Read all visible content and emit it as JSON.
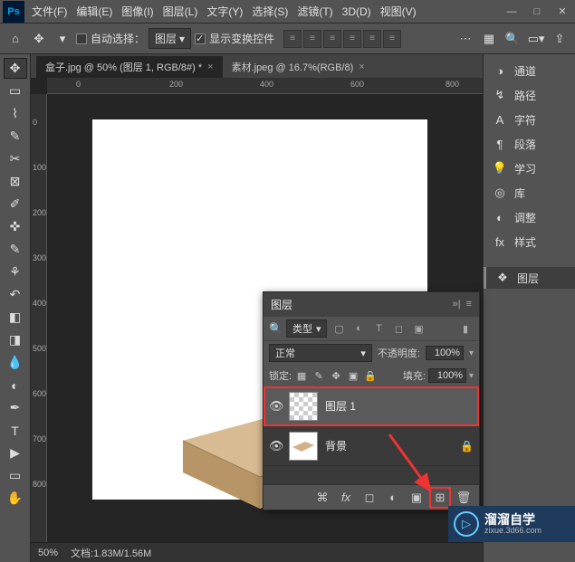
{
  "menu": {
    "items": [
      "文件(F)",
      "编辑(E)",
      "图像(I)",
      "图层(L)",
      "文字(Y)",
      "选择(S)",
      "滤镜(T)",
      "3D(D)",
      "视图(V)"
    ]
  },
  "options": {
    "auto_select_label": "自动选择：",
    "auto_select_target": "图层",
    "show_transform_controls": "显示变换控件"
  },
  "tabs": [
    {
      "label": "盒子.jpg @ 50% (图层 1, RGB/8#) *",
      "active": true
    },
    {
      "label": "素材.jpeg @ 16.7%(RGB/8)",
      "active": false
    }
  ],
  "ruler_h": [
    "0",
    "200",
    "400",
    "600",
    "800"
  ],
  "ruler_v": [
    "0",
    "100",
    "200",
    "300",
    "400",
    "500",
    "600",
    "700",
    "800"
  ],
  "status": {
    "zoom": "50%",
    "doc": "文档:",
    "size": "1.83M/1.56M"
  },
  "right_panels": [
    {
      "icon": "◑",
      "label": "通道"
    },
    {
      "icon": "↯",
      "label": "路径"
    },
    {
      "icon": "A",
      "label": "字符"
    },
    {
      "icon": "¶",
      "label": "段落"
    },
    {
      "icon": "💡",
      "label": "学习"
    },
    {
      "icon": "◎",
      "label": "库"
    },
    {
      "icon": "◐",
      "label": "调整"
    },
    {
      "icon": "fx",
      "label": "样式"
    }
  ],
  "right_active": {
    "icon": "❖",
    "label": "图层"
  },
  "layers_panel": {
    "title": "图层",
    "kind": "类型",
    "blend_mode": "正常",
    "opacity_label": "不透明度:",
    "opacity_value": "100%",
    "lock_label": "锁定:",
    "fill_label": "填充:",
    "fill_value": "100%",
    "layers": [
      {
        "name": "图层 1",
        "selected": true,
        "checker": true,
        "locked": false
      },
      {
        "name": "背景",
        "selected": false,
        "checker": false,
        "locked": true
      }
    ]
  },
  "watermark": {
    "brand": "溜溜自学",
    "url": "zixue.3d66.com"
  }
}
